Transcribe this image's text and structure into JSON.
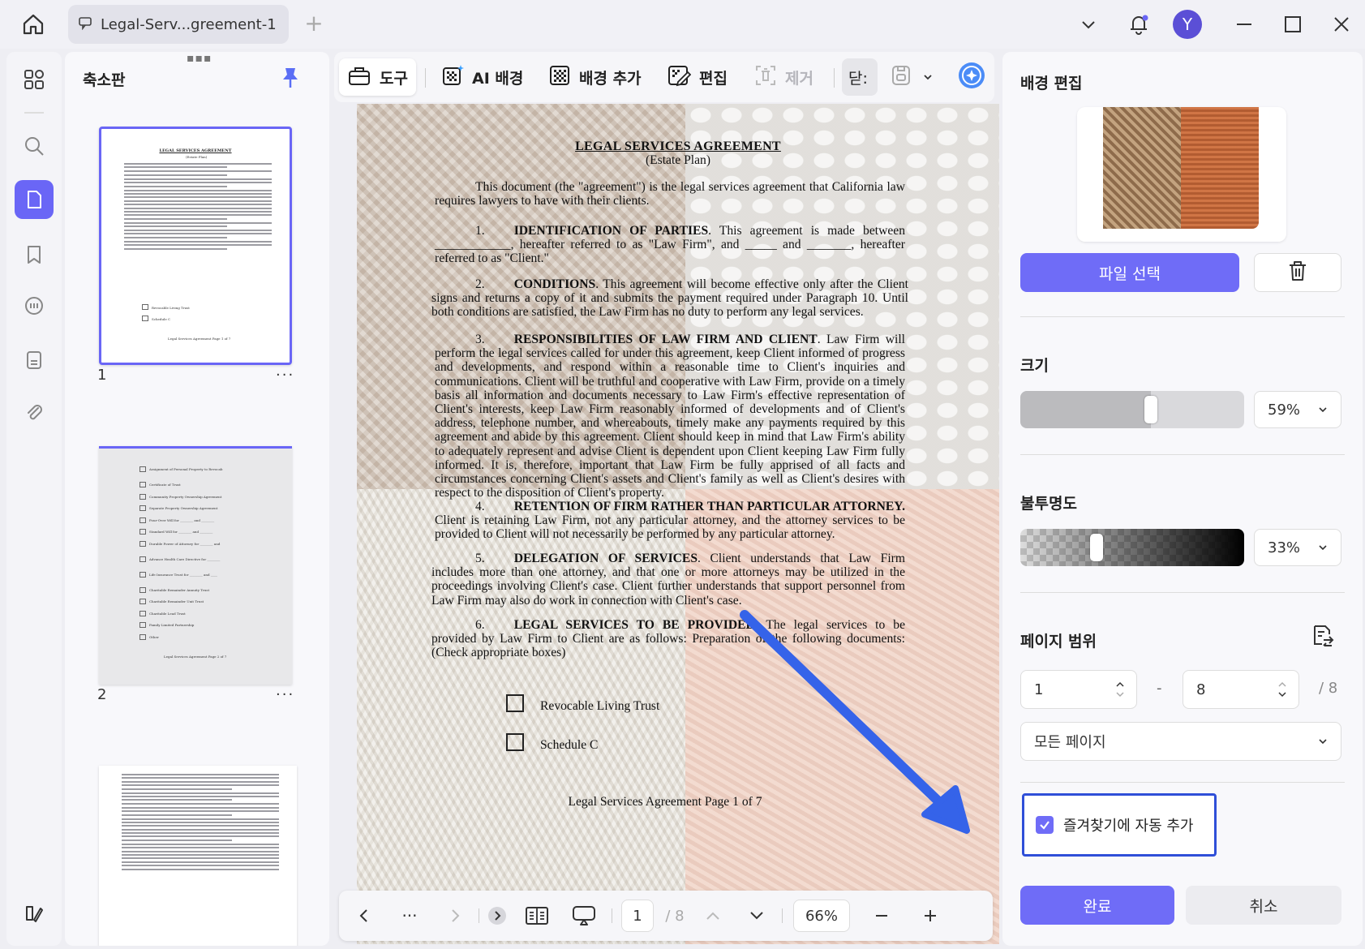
{
  "titlebar": {
    "tab_label": "Legal-Serv...greement-1",
    "avatar_letter": "Y",
    "accent": "#6a66f6"
  },
  "thumbs": {
    "title": "축소판",
    "pages": [
      {
        "number": "1",
        "more": "···"
      },
      {
        "number": "2",
        "more": "···"
      }
    ],
    "page1": {
      "title": "LEGAL SERVICES AGREEMENT",
      "subtitle": "(Estate Plan)",
      "cb1": "Revocable Living Trust",
      "cb2": "Schedule C",
      "footer": "Legal Services Agreement Page 1 of 7"
    },
    "page2": {
      "items": [
        "Assignment of Personal Property to Revocable Living Trust",
        "Certificate of Trust",
        "Community Property Ownership Agreement",
        "Separate Property Ownership Agreement",
        "Pour-Over Will for ________ and ________",
        "Standard Will for ________ and ________",
        "Durable Power of Attorney for ________ and ________",
        "Advance Health Care Directive for ________ and ________",
        "Life Insurance Trust for ________ and ________",
        "Charitable Remainder Annuity Trust",
        "Charitable Remainder Unit Trust",
        "Charitable Lead Trust",
        "Family Limited Partnership",
        "Other"
      ],
      "footer": "Legal Services Agreement Page 2 of 7"
    }
  },
  "toolbar": {
    "tool": "도구",
    "ai_bg": "AI 배경",
    "add_bg": "배경 추가",
    "edit": "편집",
    "remove": "제거",
    "close": "닫:"
  },
  "document": {
    "title": "LEGAL SERVICES AGREEMENT",
    "subtitle": "(Estate Plan)",
    "intro": "This document (the \"agreement\") is the legal services agreement that California law requires lawyers to have with their clients.",
    "s1_num": "1.",
    "s1_head": "IDENTIFICATION OF PARTIES",
    "s1_body": ". This agreement is made between ____________, hereafter referred to as \"Law Firm\", and _____ and _______, hereafter referred to as \"Client.\"",
    "s2_num": "2.",
    "s2_head": "CONDITIONS",
    "s2_body": ". This agreement will become effective only after the Client signs and returns a copy of it and submits the payment required under Paragraph 10. Until both conditions are satisfied, the Law Firm has no duty to perform any legal services.",
    "s3_num": "3.",
    "s3_head": "RESPONSIBILITIES OF LAW FIRM AND CLIENT",
    "s3_body": ". Law Firm will perform the legal services called for under this agreement, keep Client informed of progress and developments, and respond within a reasonable time to Client's inquiries and communications. Client will be truthful and cooperative with Law Firm, provide on a timely basis all information and documents necessary to Law Firm's effective representation of Client's interests, keep Law Firm reasonably informed of developments and of Client's address, telephone number, and whereabouts, timely make any payments required by this agreement and abide by this agreement. Client should keep in mind that Law Firm's ability to adequately represent and advise Client is dependent upon Client keeping Law Firm fully informed. It is, therefore, important that Law Firm be fully apprised of all facts and circumstances concerning Client's assets and Client's family as well as Client's desires with respect to the disposition of Client's property.",
    "s4_num": "4.",
    "s4_head": "RETENTION OF FIRM RATHER THAN PARTICULAR ATTORNEY.",
    "s4_body": " Client is retaining Law Firm, not any particular attorney, and the attorney services to be provided to Client will not necessarily be performed by any particular attorney.",
    "s5_num": "5.",
    "s5_head": "DELEGATION OF SERVICES",
    "s5_body": ". Client understands that Law Firm includes more than one attorney, and that one or more attorneys may be utilized in the proceedings involving Client's case. Client further understands that support personnel from Law Firm may also do work in connection with Client's case.",
    "s6_num": "6.",
    "s6_head": "LEGAL SERVICES TO BE PROVIDED",
    "s6_body": ". The legal services to be provided by Law Firm to Client are as follows: Preparation of the following documents: (Check appropriate boxes)",
    "checkbox1": "Revocable Living Trust",
    "checkbox2": "Schedule C",
    "footer": "Legal Services Agreement Page 1 of 7"
  },
  "bottombar": {
    "more": "···",
    "current_page": "1",
    "total_pages": "/ 8",
    "zoom": "66%"
  },
  "rightpanel": {
    "title": "배경 편집",
    "choose_file": "파일 선택",
    "size_label": "크기",
    "size_value": "59%",
    "size_fraction": 0.59,
    "opacity_label": "불투명도",
    "opacity_value": "33%",
    "opacity_fraction": 0.33,
    "page_range_label": "페이지 범위",
    "range_from": "1",
    "range_dash": "-",
    "range_to": "8",
    "range_total": "/ 8",
    "page_scope": "모든 페이지",
    "auto_bookmark": "즐겨찾기에 자동 추가",
    "done": "완료",
    "cancel": "취소"
  }
}
